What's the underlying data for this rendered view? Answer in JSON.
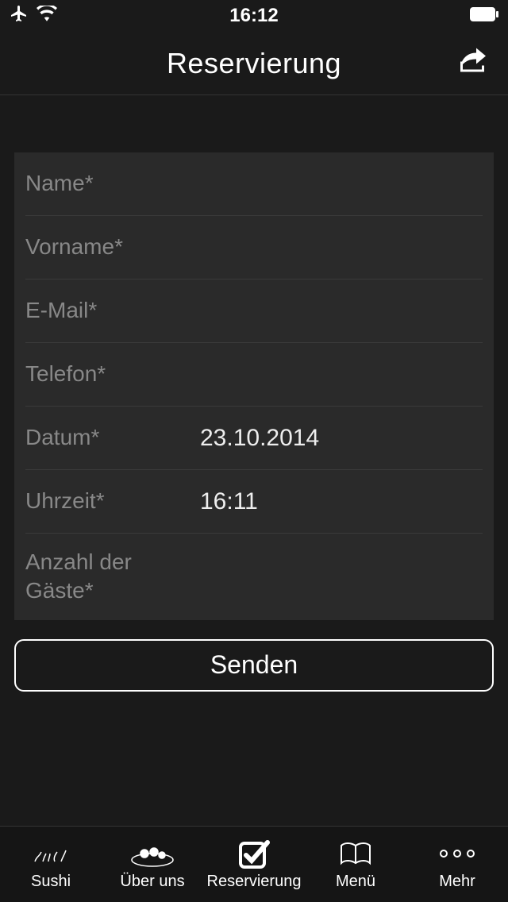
{
  "status": {
    "time": "16:12"
  },
  "nav": {
    "title": "Reservierung"
  },
  "form": {
    "name_label": "Name*",
    "vorname_label": "Vorname*",
    "email_label": "E-Mail*",
    "telefon_label": "Telefon*",
    "datum_label": "Datum*",
    "datum_value": "23.10.2014",
    "uhrzeit_label": "Uhrzeit*",
    "uhrzeit_value": "16:11",
    "gaeste_label": "Anzahl der Gäste*"
  },
  "buttons": {
    "send": "Senden"
  },
  "tabs": {
    "sushi": "Sushi",
    "ueber": "Über uns",
    "reservierung": "Reservierung",
    "menue": "Menü",
    "mehr": "Mehr"
  }
}
